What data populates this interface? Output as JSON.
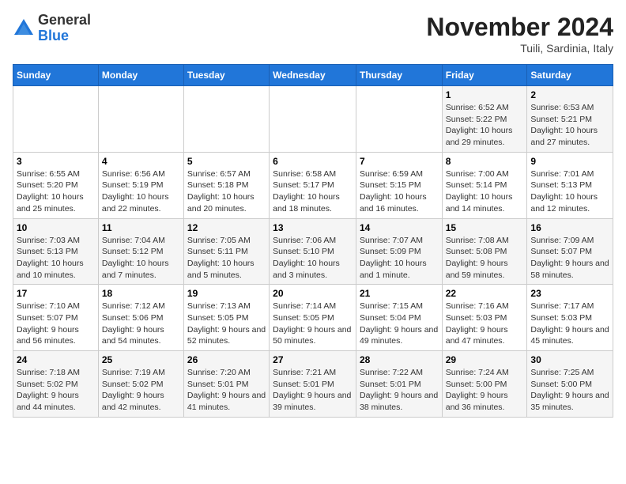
{
  "header": {
    "logo": {
      "general": "General",
      "blue": "Blue"
    },
    "month": "November 2024",
    "location": "Tuili, Sardinia, Italy"
  },
  "weekdays": [
    "Sunday",
    "Monday",
    "Tuesday",
    "Wednesday",
    "Thursday",
    "Friday",
    "Saturday"
  ],
  "weeks": [
    [
      {
        "day": "",
        "info": ""
      },
      {
        "day": "",
        "info": ""
      },
      {
        "day": "",
        "info": ""
      },
      {
        "day": "",
        "info": ""
      },
      {
        "day": "",
        "info": ""
      },
      {
        "day": "1",
        "info": "Sunrise: 6:52 AM\nSunset: 5:22 PM\nDaylight: 10 hours and 29 minutes."
      },
      {
        "day": "2",
        "info": "Sunrise: 6:53 AM\nSunset: 5:21 PM\nDaylight: 10 hours and 27 minutes."
      }
    ],
    [
      {
        "day": "3",
        "info": "Sunrise: 6:55 AM\nSunset: 5:20 PM\nDaylight: 10 hours and 25 minutes."
      },
      {
        "day": "4",
        "info": "Sunrise: 6:56 AM\nSunset: 5:19 PM\nDaylight: 10 hours and 22 minutes."
      },
      {
        "day": "5",
        "info": "Sunrise: 6:57 AM\nSunset: 5:18 PM\nDaylight: 10 hours and 20 minutes."
      },
      {
        "day": "6",
        "info": "Sunrise: 6:58 AM\nSunset: 5:17 PM\nDaylight: 10 hours and 18 minutes."
      },
      {
        "day": "7",
        "info": "Sunrise: 6:59 AM\nSunset: 5:15 PM\nDaylight: 10 hours and 16 minutes."
      },
      {
        "day": "8",
        "info": "Sunrise: 7:00 AM\nSunset: 5:14 PM\nDaylight: 10 hours and 14 minutes."
      },
      {
        "day": "9",
        "info": "Sunrise: 7:01 AM\nSunset: 5:13 PM\nDaylight: 10 hours and 12 minutes."
      }
    ],
    [
      {
        "day": "10",
        "info": "Sunrise: 7:03 AM\nSunset: 5:13 PM\nDaylight: 10 hours and 10 minutes."
      },
      {
        "day": "11",
        "info": "Sunrise: 7:04 AM\nSunset: 5:12 PM\nDaylight: 10 hours and 7 minutes."
      },
      {
        "day": "12",
        "info": "Sunrise: 7:05 AM\nSunset: 5:11 PM\nDaylight: 10 hours and 5 minutes."
      },
      {
        "day": "13",
        "info": "Sunrise: 7:06 AM\nSunset: 5:10 PM\nDaylight: 10 hours and 3 minutes."
      },
      {
        "day": "14",
        "info": "Sunrise: 7:07 AM\nSunset: 5:09 PM\nDaylight: 10 hours and 1 minute."
      },
      {
        "day": "15",
        "info": "Sunrise: 7:08 AM\nSunset: 5:08 PM\nDaylight: 9 hours and 59 minutes."
      },
      {
        "day": "16",
        "info": "Sunrise: 7:09 AM\nSunset: 5:07 PM\nDaylight: 9 hours and 58 minutes."
      }
    ],
    [
      {
        "day": "17",
        "info": "Sunrise: 7:10 AM\nSunset: 5:07 PM\nDaylight: 9 hours and 56 minutes."
      },
      {
        "day": "18",
        "info": "Sunrise: 7:12 AM\nSunset: 5:06 PM\nDaylight: 9 hours and 54 minutes."
      },
      {
        "day": "19",
        "info": "Sunrise: 7:13 AM\nSunset: 5:05 PM\nDaylight: 9 hours and 52 minutes."
      },
      {
        "day": "20",
        "info": "Sunrise: 7:14 AM\nSunset: 5:05 PM\nDaylight: 9 hours and 50 minutes."
      },
      {
        "day": "21",
        "info": "Sunrise: 7:15 AM\nSunset: 5:04 PM\nDaylight: 9 hours and 49 minutes."
      },
      {
        "day": "22",
        "info": "Sunrise: 7:16 AM\nSunset: 5:03 PM\nDaylight: 9 hours and 47 minutes."
      },
      {
        "day": "23",
        "info": "Sunrise: 7:17 AM\nSunset: 5:03 PM\nDaylight: 9 hours and 45 minutes."
      }
    ],
    [
      {
        "day": "24",
        "info": "Sunrise: 7:18 AM\nSunset: 5:02 PM\nDaylight: 9 hours and 44 minutes."
      },
      {
        "day": "25",
        "info": "Sunrise: 7:19 AM\nSunset: 5:02 PM\nDaylight: 9 hours and 42 minutes."
      },
      {
        "day": "26",
        "info": "Sunrise: 7:20 AM\nSunset: 5:01 PM\nDaylight: 9 hours and 41 minutes."
      },
      {
        "day": "27",
        "info": "Sunrise: 7:21 AM\nSunset: 5:01 PM\nDaylight: 9 hours and 39 minutes."
      },
      {
        "day": "28",
        "info": "Sunrise: 7:22 AM\nSunset: 5:01 PM\nDaylight: 9 hours and 38 minutes."
      },
      {
        "day": "29",
        "info": "Sunrise: 7:24 AM\nSunset: 5:00 PM\nDaylight: 9 hours and 36 minutes."
      },
      {
        "day": "30",
        "info": "Sunrise: 7:25 AM\nSunset: 5:00 PM\nDaylight: 9 hours and 35 minutes."
      }
    ]
  ]
}
